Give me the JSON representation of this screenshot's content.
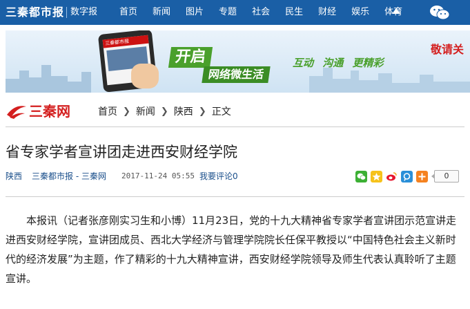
{
  "header": {
    "logo_text": "三秦都市报",
    "digital_label": "数字报",
    "nav": [
      "首页",
      "新闻",
      "图片",
      "专题",
      "社会",
      "民生",
      "财经",
      "娱乐",
      "体育"
    ],
    "wechat_icon": "wechat-icon",
    "more_icon": "triangle-up-icon"
  },
  "banner": {
    "phone_header": "三秦都市报",
    "kaiqi": "开启",
    "weishenghuo": "网络微生活",
    "tags": [
      "互动",
      "沟通",
      "更精彩"
    ],
    "please": "敬请关"
  },
  "site": {
    "name": "三秦网"
  },
  "breadcrumb": [
    "首页",
    "新闻",
    "陕西",
    "正文"
  ],
  "article": {
    "title": "省专家学者宣讲团走进西安财经学院",
    "channel": "陕西",
    "source": "三秦都市报 - 三秦网",
    "date": "2017-11-24 05:55",
    "comment": "我要评论0",
    "share_count": "0",
    "share_icons": [
      "wechat-share-icon",
      "qzone-share-icon",
      "weibo-share-icon",
      "tencent-share-icon",
      "more-share-icon"
    ],
    "body": "本报讯（记者张彦刚实习生和小博）11月23日，党的十九大精神省专家学者宣讲团示范宣讲走进西安财经学院，宣讲团成员、西北大学经济与管理学院院长任保平教授以“中国特色社会主义新时代的经济发展”为主题，作了精彩的十九大精神宣讲，西安财经学院领导及师生代表认真聆听了主题宣讲。"
  },
  "colors": {
    "nav_bg": "#1a5fa6",
    "brand_red": "#d41f1f",
    "link_blue": "#1a4f8b",
    "banner_green": "#4aa02c"
  }
}
